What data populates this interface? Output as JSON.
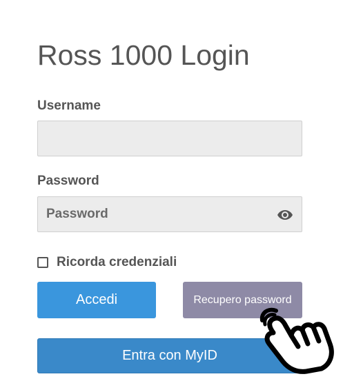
{
  "login": {
    "title": "Ross 1000 Login",
    "username_label": "Username",
    "username_value": "",
    "password_label": "Password",
    "password_placeholder": "Password",
    "show_password_icon": "eye-icon",
    "remember_label": "Ricorda credenziali",
    "remember_checked": false,
    "accedi_label": "Accedi",
    "recupero_label": "Recupero password",
    "myid_label": "Entra con MyID"
  },
  "colors": {
    "primary": "#3a96dd",
    "myid": "#3a89c9",
    "secondary": "#8e8aa6",
    "text": "#555555",
    "field_bg": "#ececec"
  },
  "cursor": {
    "icon": "hand-pointer-icon"
  }
}
